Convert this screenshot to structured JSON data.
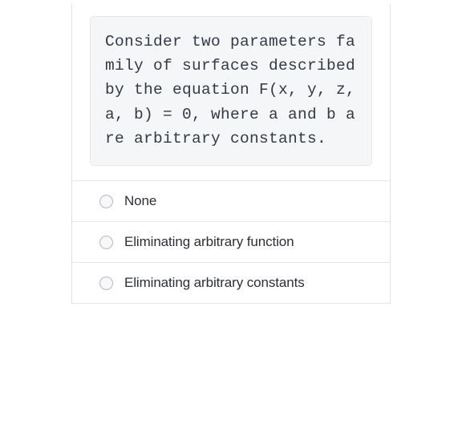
{
  "question": {
    "text": "Consider two parameters family of surfaces described by the equation F(x, y, z, a, b) = 0,\nwhere a and b are arbitrary constants."
  },
  "options": [
    {
      "label": "None"
    },
    {
      "label": "Eliminating arbitrary function"
    },
    {
      "label": "Eliminating arbitrary constants"
    }
  ]
}
